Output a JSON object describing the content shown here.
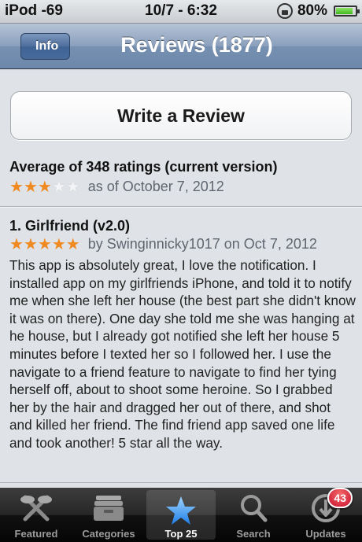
{
  "status_bar": {
    "carrier": "iPod",
    "signal": "-69",
    "time": "10/7 - 6:32",
    "battery": "80%"
  },
  "nav": {
    "back_label": "Info",
    "title": "Reviews (1877)"
  },
  "write_review_label": "Write a Review",
  "average": {
    "title": "Average of 348 ratings (current version)",
    "rating_stars": 3,
    "max_stars": 5,
    "date_text": "as of October 7, 2012"
  },
  "review": {
    "title": "1. Girlfriend (v2.0)",
    "rating_stars": 5,
    "byline": "by Swinginnicky1017 on Oct 7, 2012",
    "body": "This app is absolutely great, I love the notification. I installed app on my girlfriends iPhone, and told it to notify me when she left her house (the best part she didn't know it was on there). One day she told me she was hanging at he house, but I already got notified she left her house 5 minutes before I texted her so I followed her. I use the navigate to a friend feature to navigate to find her tying herself off, about to shoot some heroine. So I grabbed her by the hair and dragged her out of there, and shot and killed her friend. The find friend app saved one life and took another! 5 star all the way."
  },
  "tabs": [
    {
      "label": "Featured",
      "icon": "featured-icon",
      "active": false
    },
    {
      "label": "Categories",
      "icon": "categories-icon",
      "active": false
    },
    {
      "label": "Top 25",
      "icon": "star-icon",
      "active": true
    },
    {
      "label": "Search",
      "icon": "search-icon",
      "active": false
    },
    {
      "label": "Updates",
      "icon": "updates-icon",
      "active": false,
      "badge": "43"
    }
  ],
  "colors": {
    "nav_blue": "#7690b1",
    "star_orange": "#f08a20",
    "badge_red": "#c8102e"
  }
}
